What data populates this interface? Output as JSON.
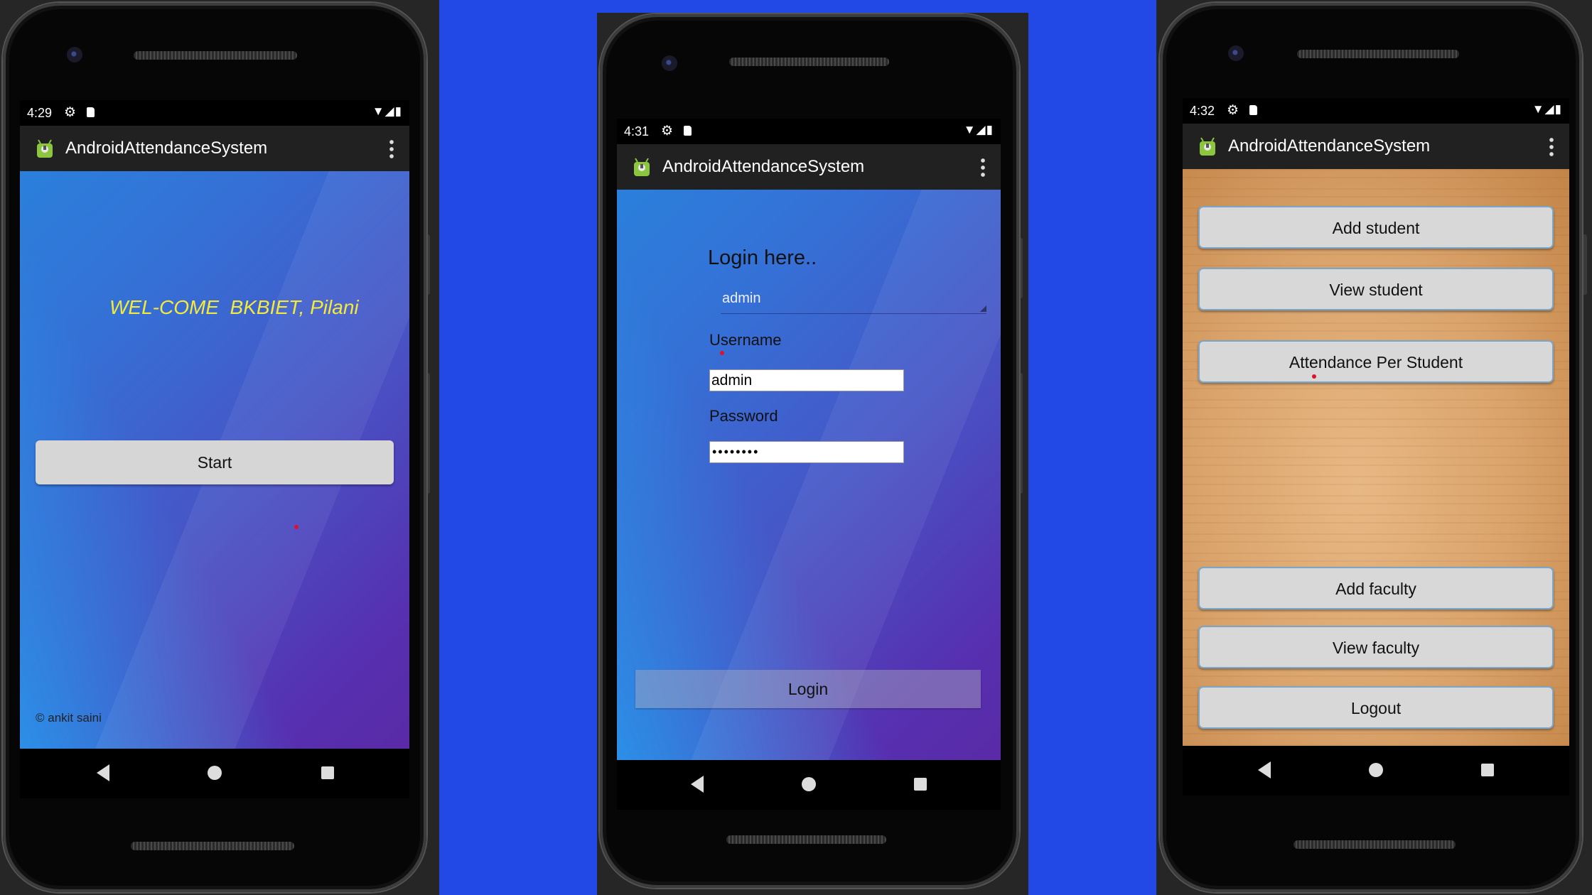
{
  "app_title": "AndroidAttendanceSystem",
  "screen1": {
    "time": "4:29",
    "welcome": "WEL-COME  BKBIET, Pilani",
    "start_button": "Start",
    "footer": "© ankit saini"
  },
  "screen2": {
    "time": "4:31",
    "heading": "Login here..",
    "spinner_value": "admin",
    "username_label": "Username",
    "username_value": "admin",
    "password_label": "Password",
    "password_value": "••••••••",
    "login_button": "Login"
  },
  "screen3": {
    "time": "4:32",
    "buttons": [
      "Add student",
      "View student",
      "Attendance Per Student",
      "Add faculty",
      "View faculty",
      "Logout"
    ]
  },
  "status_icons": [
    "gear-icon",
    "sd-card-icon",
    "wifi-icon",
    "signal-icon",
    "battery-icon"
  ],
  "colors": {
    "background_blue": "#2249e6",
    "welcome_yellow": "#f3ea3b",
    "app_bar": "#212121"
  }
}
